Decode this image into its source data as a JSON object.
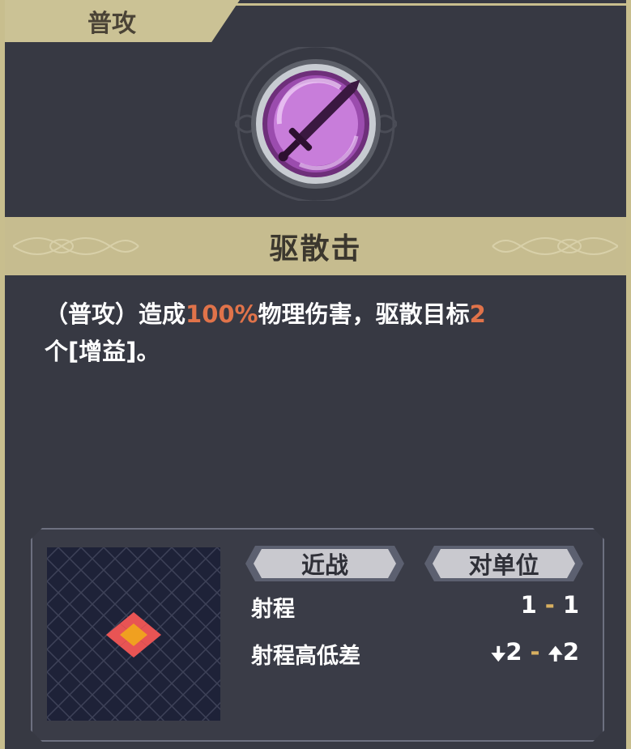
{
  "tab": {
    "label": "普攻"
  },
  "skill": {
    "icon": "sword-icon",
    "name": "驱散击",
    "description": {
      "p1": "（普攻）造成",
      "p2": "100%",
      "p3": "物理伤害，驱散目标",
      "p4": "2",
      "p5": "个[增益]。"
    }
  },
  "stats": {
    "tags": [
      "近战",
      "对单位"
    ],
    "range_label": "射程",
    "range_min": "1",
    "range_max": "1",
    "height_label": "射程高低差",
    "height_down": "2",
    "height_up": "2"
  },
  "colors": {
    "highlight": "#e0734a",
    "gold": "#c8be8e",
    "panel": "#3a3c47"
  }
}
